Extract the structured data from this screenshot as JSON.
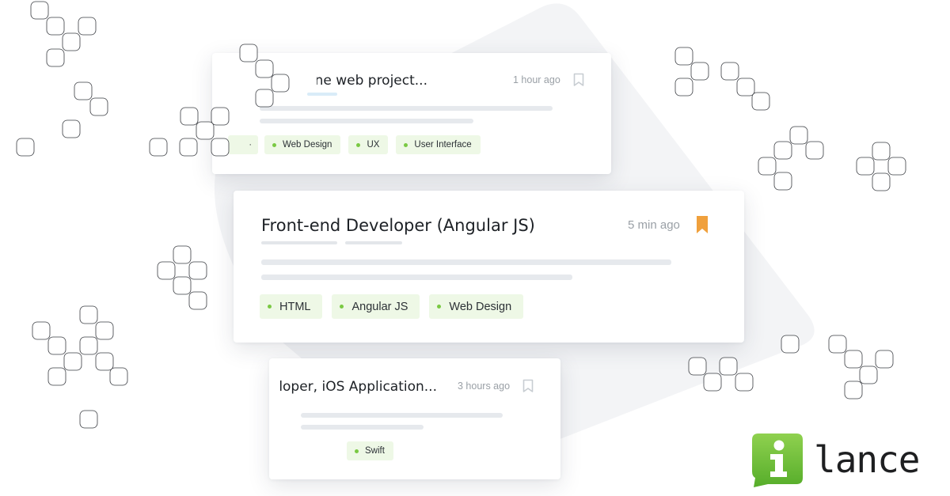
{
  "cards": [
    {
      "title": "...ne web project",
      "time": "1 hour ago",
      "bookmarked": false,
      "tags": [
        "Web Design",
        "UX",
        "User Interface"
      ]
    },
    {
      "title": "Front-end Developer (Angular JS)",
      "time": "5 min ago",
      "bookmarked": true,
      "tags": [
        "HTML",
        "Angular JS",
        "Web Design"
      ]
    },
    {
      "title": "...loper, iOS Application",
      "time": "3 hours ago",
      "bookmarked": false,
      "tags": [
        "Swift"
      ]
    }
  ],
  "logo": {
    "wordmark": "lance",
    "icon": "i-letter-icon",
    "brand_color": "#6dc033"
  },
  "colors": {
    "bookmark_active": "#f0a03c",
    "bookmark_inactive": "#c8cdd2",
    "tag_background": "#eef8e6",
    "tag_dot": "#7ac943"
  }
}
